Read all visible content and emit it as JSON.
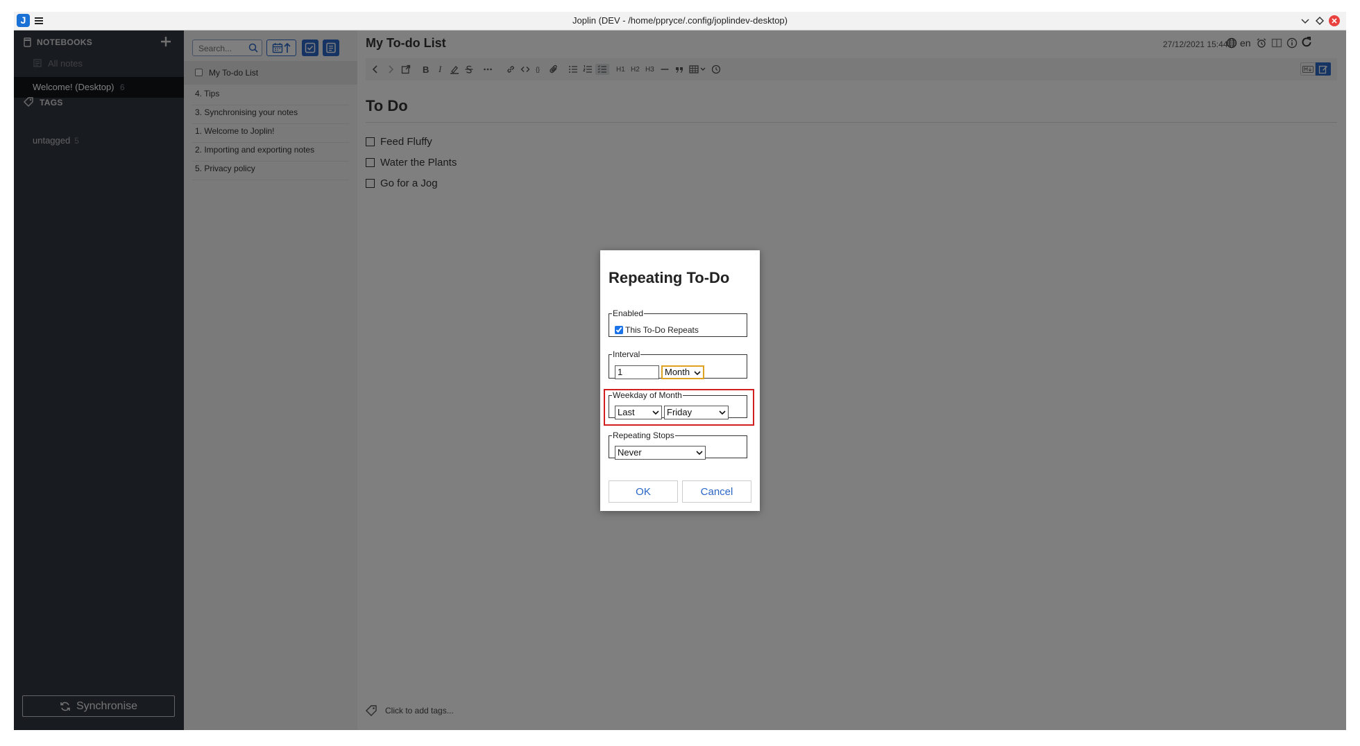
{
  "window": {
    "title": "Joplin (DEV - /home/ppryce/.config/joplindev-desktop)",
    "logo_letter": "J"
  },
  "sidebar": {
    "notebooks_header": "NOTEBOOKS",
    "all_notes": "All notes",
    "notebooks": [
      {
        "label": "Welcome! (Desktop)",
        "count": "6"
      }
    ],
    "tags_header": "TAGS",
    "tags": [
      {
        "label": "untagged",
        "count": "5"
      }
    ],
    "sync_button": "Synchronise"
  },
  "notes_list": {
    "search_placeholder": "Search...",
    "items": [
      {
        "title": "My To-do List",
        "is_todo": true,
        "selected": true
      },
      {
        "title": "4. Tips"
      },
      {
        "title": "3. Synchronising your notes"
      },
      {
        "title": "1. Welcome to Joplin!"
      },
      {
        "title": "2. Importing and exporting notes"
      },
      {
        "title": "5. Privacy policy"
      }
    ]
  },
  "editor": {
    "note_title": "My To-do List",
    "datetime": "27/12/2021 15:44",
    "language": "en",
    "toolbar": {
      "h1": "H1",
      "h2": "H2",
      "h3": "H3"
    },
    "heading": "To Do",
    "todos": [
      {
        "label": "Feed Fluffy",
        "checked": false
      },
      {
        "label": "Water the Plants",
        "checked": false
      },
      {
        "label": "Go for a Jog",
        "checked": false
      }
    ],
    "tags_placeholder": "Click to add tags..."
  },
  "dialog": {
    "title": "Repeating To-Do",
    "enabled_legend": "Enabled",
    "repeat_checkbox_label": "This To-Do Repeats",
    "repeat_checked": true,
    "interval_legend": "Interval",
    "interval_value": "1",
    "interval_unit": "Month",
    "weekday_legend": "Weekday of Month",
    "weekday_ordinal": "Last",
    "weekday_day": "Friday",
    "stops_legend": "Repeating Stops",
    "stops_value": "Never",
    "ok_button": "OK",
    "cancel_button": "Cancel"
  },
  "colors": {
    "sidebar_bg": "#313640",
    "selected_notebook_bg": "#131416",
    "accent_blue": "#2a66c6",
    "highlight_red": "#d21f1f",
    "interval_unit_border": "#e0a020"
  }
}
